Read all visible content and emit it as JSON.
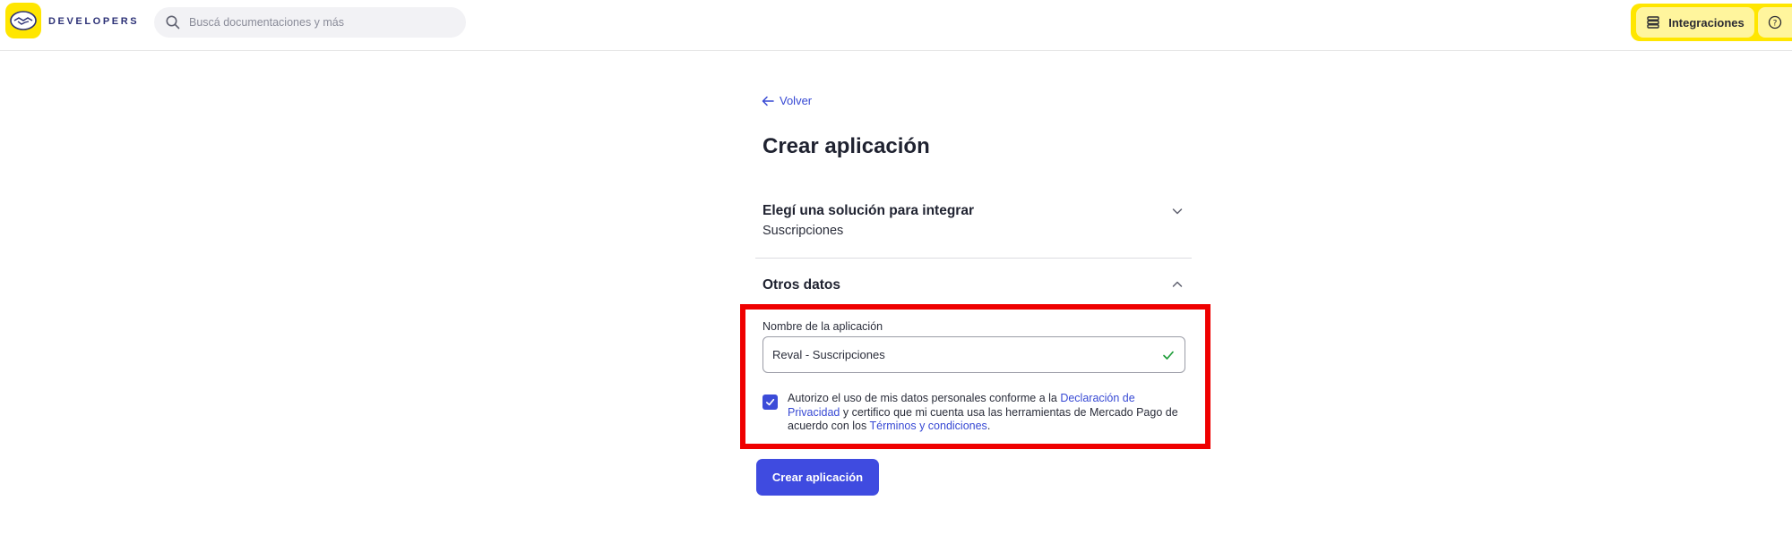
{
  "header": {
    "brand": "DEVELOPERS",
    "search_placeholder": "Buscá documentaciones y más",
    "integrations_label": "Integraciones",
    "accent_color": "#ffe600"
  },
  "main": {
    "back_label": "Volver",
    "page_title": "Crear aplicación",
    "solution_section": {
      "title": "Elegí una solución para integrar",
      "value": "Suscripciones",
      "state": "collapsed"
    },
    "other_section": {
      "title": "Otros datos",
      "state": "expanded",
      "app_name_label": "Nombre de la aplicación",
      "app_name_value": "Reval - Suscripciones",
      "consent": {
        "checked": true,
        "text_1": "Autorizo el uso de mis datos personales conforme a la ",
        "link_privacy": "Declaración de Privacidad",
        "text_2": " y certifico que mi cuenta usa las herramientas de Mercado Pago de acuerdo con los ",
        "link_terms": "Términos y condiciones",
        "text_3": "."
      }
    },
    "submit_label": "Crear aplicación",
    "primary_color": "#3f4be0",
    "highlight_color": "#ef0000"
  }
}
